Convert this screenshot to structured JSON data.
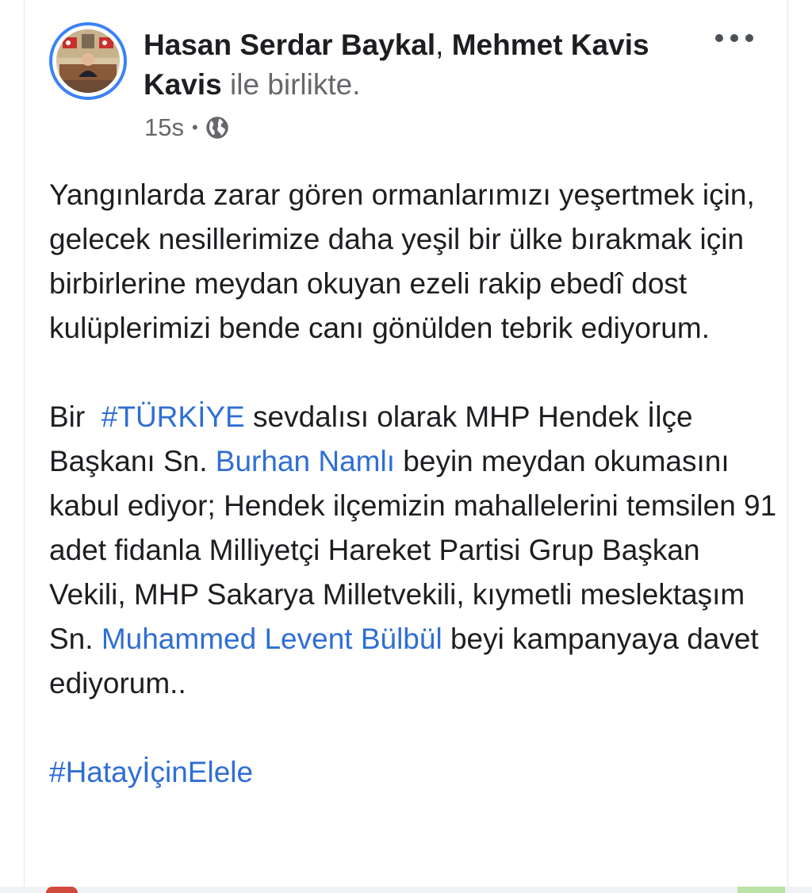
{
  "post": {
    "authors": [
      "Hasan Serdar Baykal",
      "Mehmet Kavis Kavis"
    ],
    "author_separator": ", ",
    "with_text": " ile birlikte.",
    "time": "15s",
    "meta_dot": "•",
    "privacy_icon": "globe-icon",
    "more_icon": "more-options-icon",
    "paragraph1": "Yangınlarda zarar gören ormanlarımızı yeşertmek için, gelecek nesillerimize daha yeşil bir ülke bırakmak için birbirlerine meydan okuyan ezeli rakip ebedî dost kulüplerimizi bende canı gönülden tebrik ediyorum.",
    "paragraph2": {
      "t1": "Bir  ",
      "hashtag1": "#TÜRKİYE",
      "t2": " sevdalısı olarak MHP Hendek İlçe Başkanı Sn. ",
      "mention1": "Burhan Namlı",
      "t3": " beyin meydan okumasını kabul ediyor; Hendek ilçemizin mahallelerini temsilen 91 adet fidanla Milliyetçi Hareket Partisi Grup Başkan Vekili, MHP Sakarya Milletvekili, kıymetli meslektaşım Sn. ",
      "mention2": "Muhammed Levent Bülbül",
      "t4": " beyi kampanyaya davet ediyorum.."
    },
    "hashtag2": "#HatayİçinElele"
  },
  "colors": {
    "link": "#2f6ed4",
    "avatar_ring": "#3b82f6",
    "muted": "#65676b",
    "text": "#1c1e21"
  }
}
